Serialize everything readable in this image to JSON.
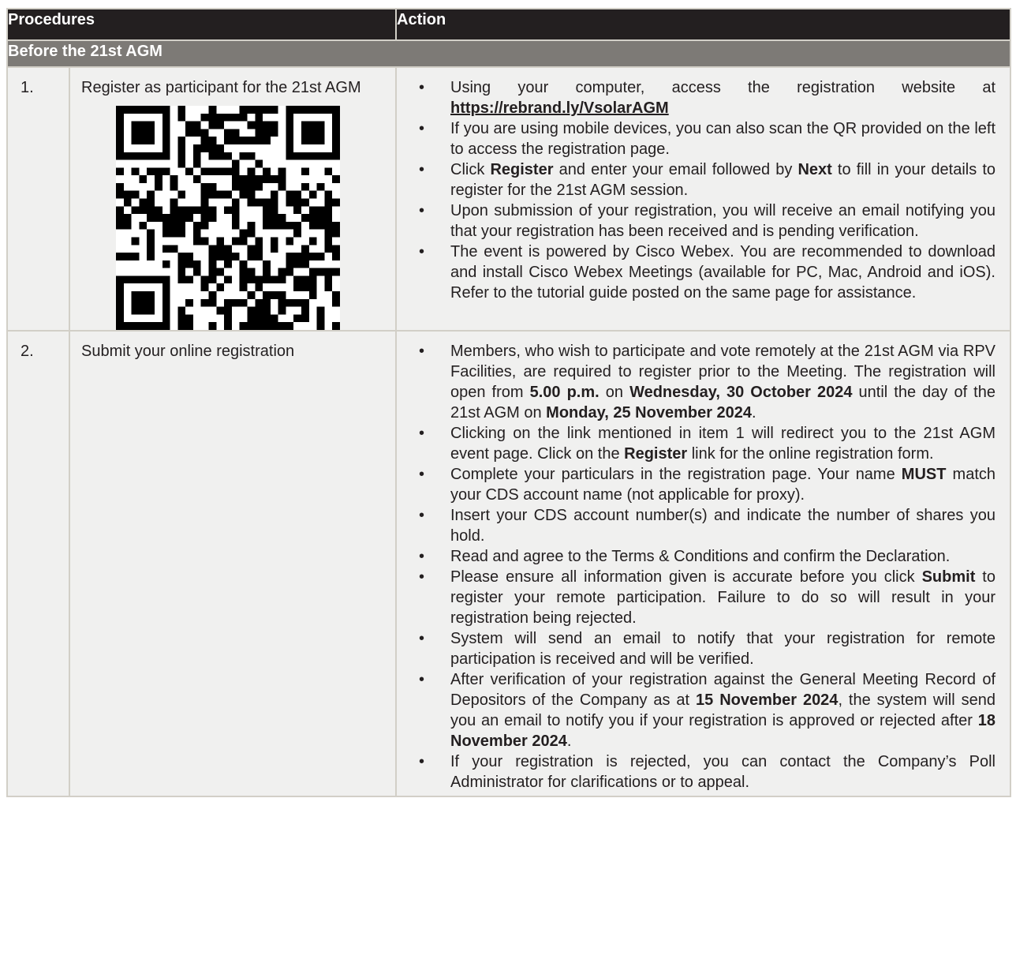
{
  "header": {
    "procedures": "Procedures",
    "action": "Action"
  },
  "section": {
    "title": "Before the 21st AGM"
  },
  "rows": [
    {
      "number": "1.",
      "procedure": "Register as participant for the 21st AGM",
      "qr_icon": "qr-code-icon",
      "actions": {
        "a1_pre": "Using your computer, access the registration website at ",
        "a1_link": "https://rebrand.ly/VsolarAGM",
        "a2": "If you are using mobile devices, you can also scan the QR provided on the left to access the registration page.",
        "a3_pre": "Click ",
        "a3_b1": "Register",
        "a3_mid": " and enter your email followed by ",
        "a3_b2": "Next",
        "a3_post": " to fill in your details to register for the 21st AGM session.",
        "a4": "Upon submission of your registration, you will receive an email notifying you that your registration has been received and is pending verification.",
        "a5": "The event is powered by Cisco Webex. You are recommended to download and install Cisco Webex Meetings (available for PC, Mac, Android and iOS). Refer to the tutorial guide posted on the same page for assistance."
      }
    },
    {
      "number": "2.",
      "procedure": "Submit your online registration",
      "actions": {
        "b1_pre": "Members, who wish to participate and vote remotely at the 21st AGM via RPV Facilities, are required to register prior to the Meeting. The registration will open from ",
        "b1_b1": "5.00 p.m.",
        "b1_mid1": " on ",
        "b1_b2": "Wednesday, 30 October 2024",
        "b1_mid2": " until the day of the 21st AGM on ",
        "b1_b3": "Monday, 25 November 2024",
        "b1_post": ".",
        "b2_pre": "Clicking on the link mentioned in item 1 will redirect you to the 21st AGM event page. Click on the ",
        "b2_b": "Register",
        "b2_post": " link for the online registration form.",
        "b3_pre": "Complete your particulars in the registration page. Your name ",
        "b3_b": "MUST",
        "b3_post": " match your CDS account name (not applicable for proxy).",
        "b4": "Insert your CDS account number(s) and indicate the number of shares you hold.",
        "b5": "Read and agree to the Terms & Conditions and confirm the Declaration.",
        "b6_pre": "Please ensure all information given is accurate before you click ",
        "b6_b": "Submit",
        "b6_post": " to register your remote participation. Failure to do so will result in your registration being rejected.",
        "b7": "System will send an email to notify that your registration for remote participation is received and will be verified.",
        "b8_pre": "After verification of your registration against the General Meeting Record of Depositors of the Company as at ",
        "b8_b1": "15 November 2024",
        "b8_mid": ", the system will send you an email to notify you if your registration is approved or rejected after ",
        "b8_b2": "18 November 2024",
        "b8_post": ".",
        "b9": "If your registration is rejected, you can contact the Company’s Poll Administrator for clarifications or to appeal."
      }
    }
  ],
  "bullet": "•",
  "colors": {
    "header_bg": "#231f20",
    "section_bg": "#7d7a76",
    "row_bg": "#f0f0ef",
    "border": "#d2cfc7"
  }
}
